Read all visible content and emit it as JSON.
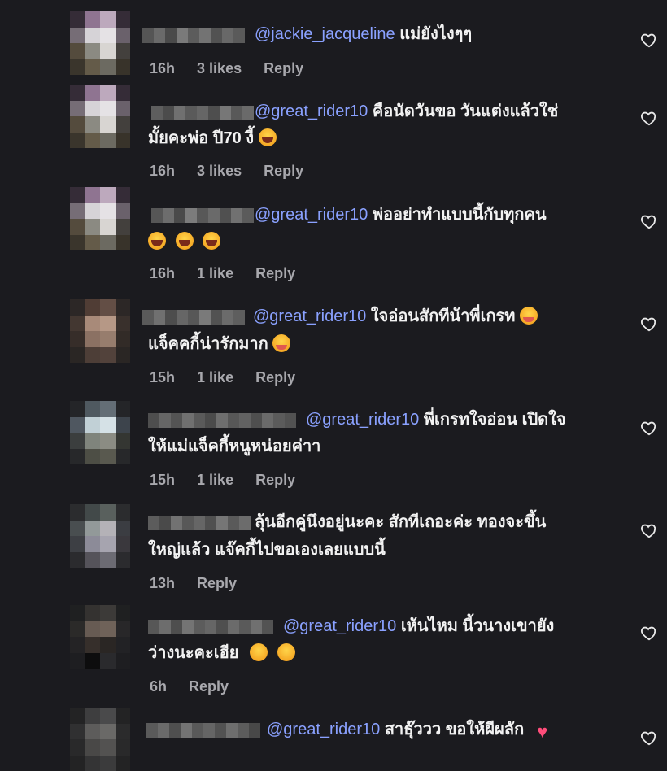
{
  "comments": [
    {
      "mention": "@jackie_jacqueline",
      "text_line1": "แม่ยังไงๆๆ",
      "text_line2": "",
      "time": "16h",
      "likes": "3 likes",
      "reply": "Reply"
    },
    {
      "mention": "@great_rider10",
      "text_line1": "คือนัดวันขอ วันแต่งแล้วใช่",
      "text_line2": "มั้ยคะพ่อ ปี70 งี้",
      "time": "16h",
      "likes": "3 likes",
      "reply": "Reply"
    },
    {
      "mention": "@great_rider10",
      "text_line1": "พ่ออย่าทำแบบนี้กับทุกคน",
      "text_line2": "",
      "time": "16h",
      "likes": "1 like",
      "reply": "Reply"
    },
    {
      "mention": "@great_rider10",
      "text_line1": "ใจอ่อนสักทีน้าพี่เกรท",
      "text_line2": "แจ็คคกี้น่ารักมาก",
      "time": "15h",
      "likes": "1 like",
      "reply": "Reply"
    },
    {
      "mention": "@great_rider10",
      "text_line1": "พี่เกรทใจอ่อน เปิดใจ",
      "text_line2": "ให้แม่แจ็คกี้หนูหน่อยค่าา",
      "time": "15h",
      "likes": "1 like",
      "reply": "Reply"
    },
    {
      "mention": "",
      "text_line1": "ลุ้นอีกคู่นึงอยู่นะคะ สักทีเถอะค่ะ ทองจะขึ้น",
      "text_line2": "ใหญ่แล้ว แจ๊คกี้ไปขอเองเลยแบบนี้",
      "time": "13h",
      "likes": "",
      "reply": "Reply"
    },
    {
      "mention": "@great_rider10",
      "text_line1": "เห้นไหม นี้วนางเขายัง",
      "text_line2": "ว่างนะคะเฮีย",
      "time": "6h",
      "likes": "",
      "reply": "Reply"
    },
    {
      "mention": "@great_rider10",
      "text_line1": "สาธุ๊ววว ขอให้ผีผลัก",
      "text_line2": "",
      "time": "",
      "likes": "",
      "reply": ""
    }
  ],
  "icons": {
    "like": "heart-outline-icon",
    "laugh": "laughing-face-emoji",
    "hug": "smiling-face-with-hearts-emoji",
    "shush": "face-with-hand-over-mouth-emoji",
    "heart": "red-heart-emoji"
  },
  "colors": {
    "background": "#1b1b1f",
    "mention": "#8aa1ff",
    "meta": "#a8a8ad",
    "text": "#f2f2f2"
  }
}
